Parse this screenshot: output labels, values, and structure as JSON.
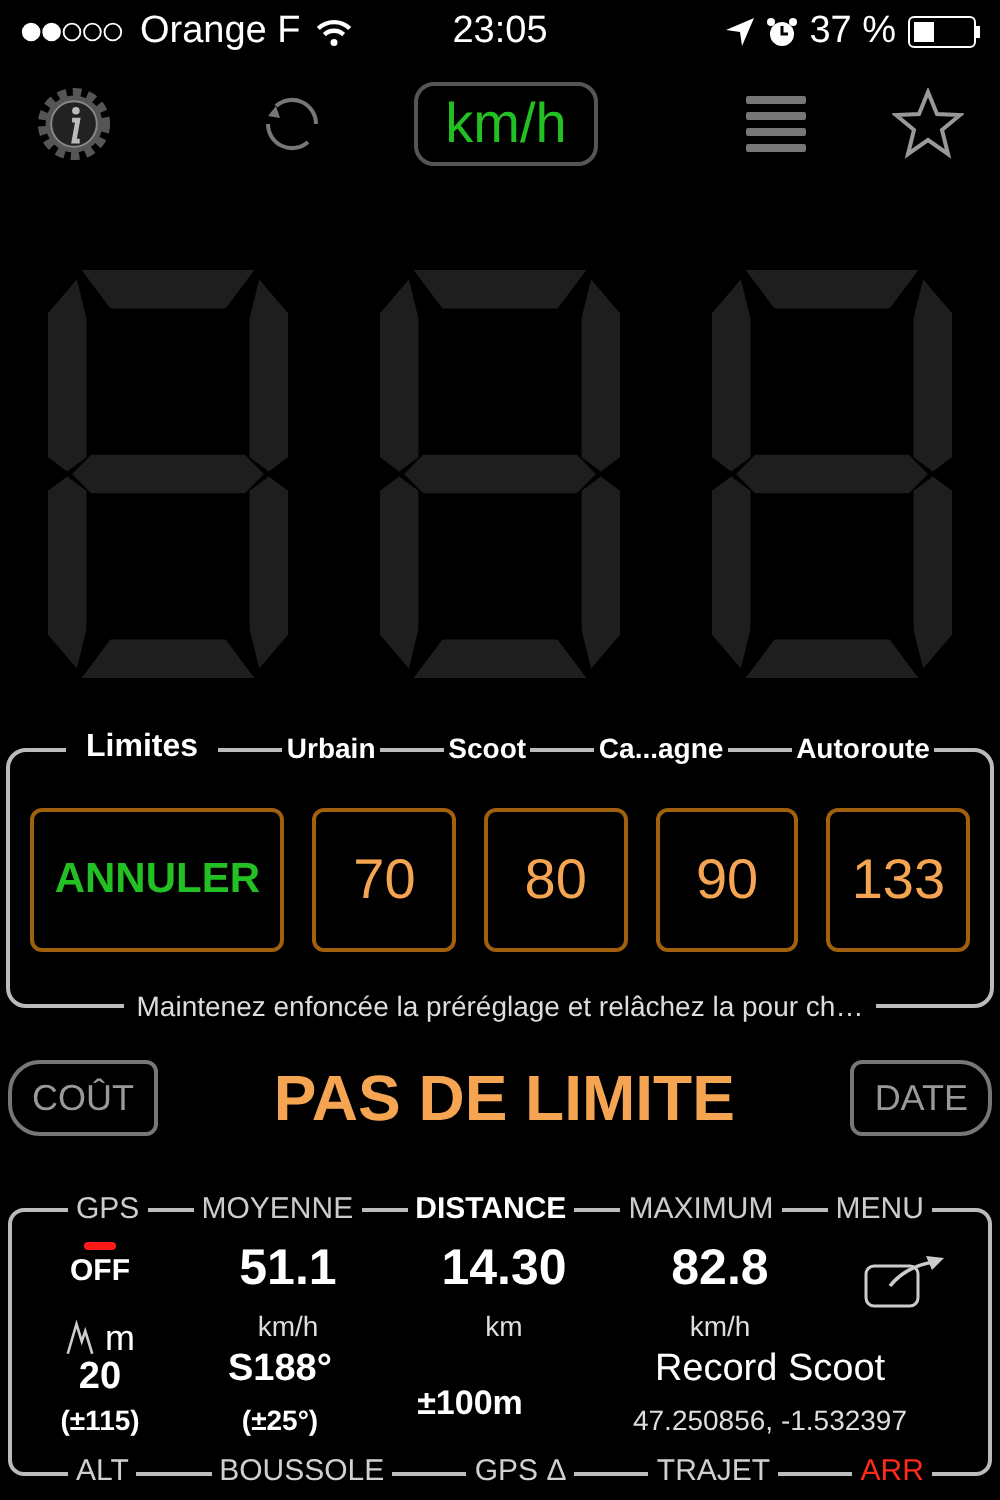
{
  "status_bar": {
    "carrier": "Orange F",
    "time": "23:05",
    "battery": "37 %"
  },
  "toolbar": {
    "unit": "km/h"
  },
  "limits": {
    "title": "Limites",
    "cancel": "ANNULER",
    "presets": [
      {
        "label": "Urbain",
        "value": "70"
      },
      {
        "label": "Scoot",
        "value": "80"
      },
      {
        "label": "Ca...agne",
        "value": "90"
      },
      {
        "label": "Autoroute",
        "value": "133"
      }
    ],
    "hint": "Maintenez enfoncée la préréglage et relâchez la pour ch…"
  },
  "nav": {
    "prev": "COÛT",
    "title": "PAS DE LIMITE",
    "next": "DATE"
  },
  "stats": {
    "top_labels": [
      {
        "text": "GPS",
        "selected": false
      },
      {
        "text": "MOYENNE",
        "selected": false
      },
      {
        "text": "DISTANCE",
        "selected": true
      },
      {
        "text": "MAXIMUM",
        "selected": false
      },
      {
        "text": "MENU",
        "selected": false
      }
    ],
    "gps": {
      "on": false,
      "state": "OFF"
    },
    "values": [
      {
        "value": "51.1",
        "unit": "km/h"
      },
      {
        "value": "14.30",
        "unit": "km"
      },
      {
        "value": "82.8",
        "unit": "km/h"
      }
    ],
    "altitude": {
      "unit": "m",
      "value": "20",
      "accuracy": "(±115)"
    },
    "compass": {
      "value": "S188°",
      "accuracy": "(±25°)"
    },
    "gps_delta": "±100m",
    "trip": {
      "name": "Record Scoot",
      "coords": "47.250856, -1.532397"
    },
    "bottom_labels": [
      {
        "text": "ALT",
        "color": "#d0d0d0"
      },
      {
        "text": "BOUSSOLE",
        "color": "#d0d0d0"
      },
      {
        "text": "GPS Δ",
        "color": "#d0d0d0"
      },
      {
        "text": "TRAJET",
        "color": "#d0d0d0"
      },
      {
        "text": "ARR",
        "color": "#ff2a1a"
      }
    ]
  }
}
